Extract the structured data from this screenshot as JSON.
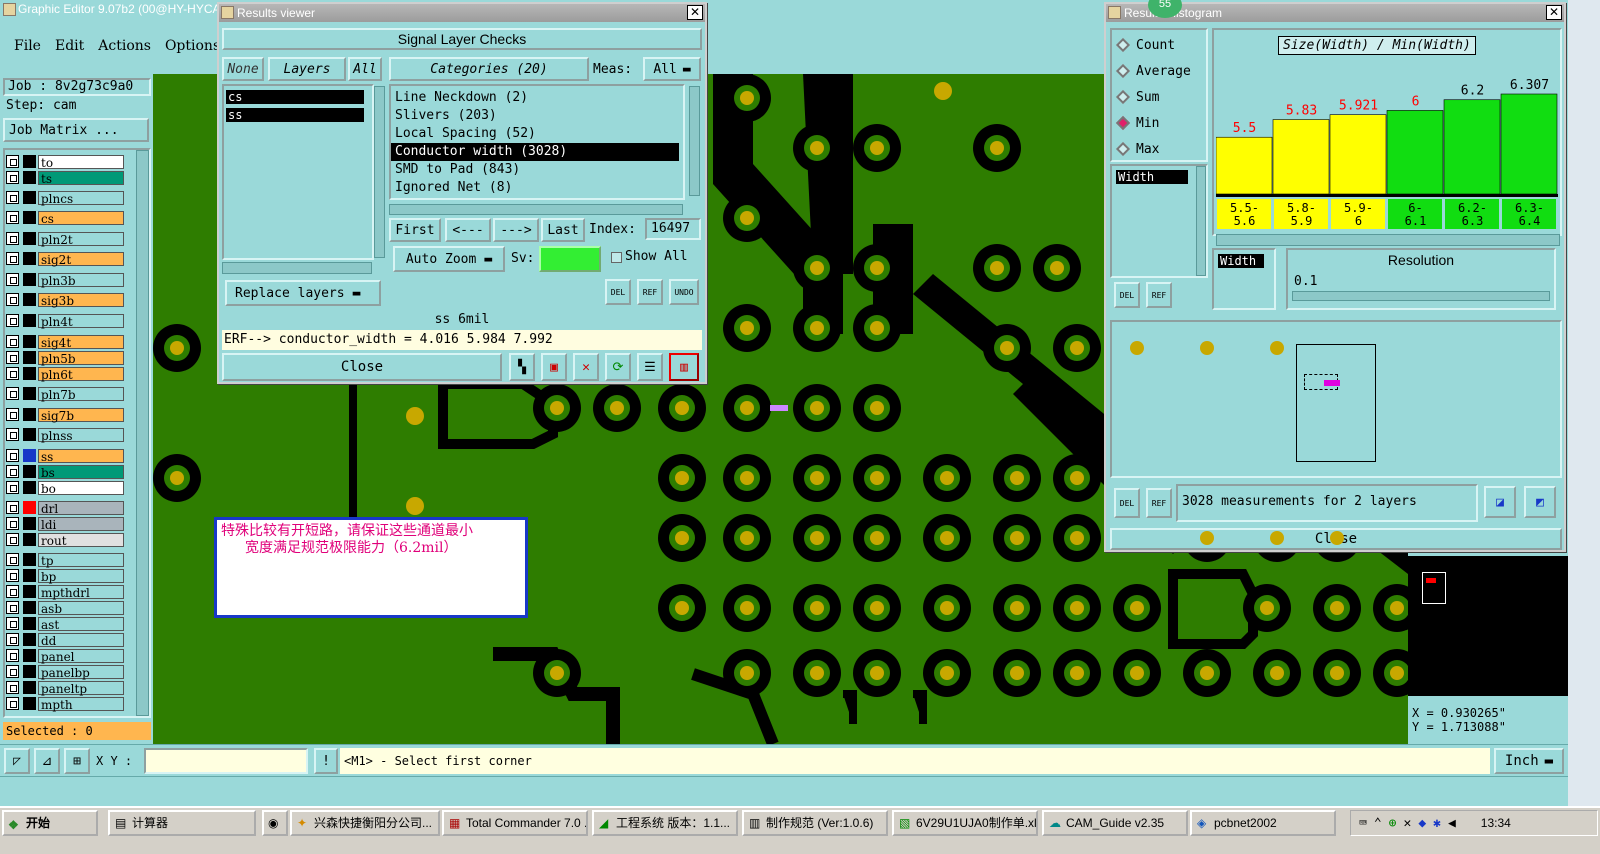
{
  "app": {
    "title": "Graphic Editor 9.07b2 (00@HY-HYCA"
  },
  "menu": [
    "File",
    "Edit",
    "Actions",
    "Options"
  ],
  "job": {
    "job_label": "Job : 8v2g73c9a0",
    "step_label": "Step: cam",
    "matrix_button": "Job Matrix ..."
  },
  "layers": [
    {
      "name": "to",
      "color": "#ffffff"
    },
    {
      "name": "ts",
      "color": "#009977"
    },
    {
      "name": "plncs",
      "color": "#9ad9d9"
    },
    {
      "name": "cs",
      "color": "#ffb64f"
    },
    {
      "name": "pln2t",
      "color": "#9ad9d9"
    },
    {
      "name": "sig2t",
      "color": "#ffb64f"
    },
    {
      "name": "pln3b",
      "color": "#9ad9d9"
    },
    {
      "name": "sig3b",
      "color": "#ffb64f"
    },
    {
      "name": "pln4t",
      "color": "#9ad9d9"
    },
    {
      "name": "sig4t",
      "color": "#ffb64f"
    },
    {
      "name": "pln5b",
      "color": "#ffb64f"
    },
    {
      "name": "pln6t",
      "color": "#ffb64f"
    },
    {
      "name": "pln7b",
      "color": "#9ad9d9"
    },
    {
      "name": "sig7b",
      "color": "#ffb64f"
    },
    {
      "name": "plnss",
      "color": "#9ad9d9"
    },
    {
      "name": "ss",
      "color": "#ffb64f"
    },
    {
      "name": "bs",
      "color": "#009977"
    },
    {
      "name": "bo",
      "color": "#ffffff"
    },
    {
      "name": "drl",
      "color": "#a9b4bb"
    },
    {
      "name": "ldi",
      "color": "#a9b4bb"
    },
    {
      "name": "rout",
      "color": "#e0e0e0"
    },
    {
      "name": "tp",
      "color": "#9ad9d9"
    },
    {
      "name": "bp",
      "color": "#9ad9d9"
    },
    {
      "name": "mpthdrl",
      "color": "#9ad9d9"
    },
    {
      "name": "asb",
      "color": "#9ad9d9"
    },
    {
      "name": "ast",
      "color": "#9ad9d9"
    },
    {
      "name": "dd",
      "color": "#9ad9d9"
    },
    {
      "name": "panel",
      "color": "#9ad9d9"
    },
    {
      "name": "panelbp",
      "color": "#9ad9d9"
    },
    {
      "name": "paneltp",
      "color": "#9ad9d9"
    },
    {
      "name": "mpth",
      "color": "#9ad9d9"
    }
  ],
  "selected": "Selected : 0",
  "results": {
    "title": "Results viewer",
    "header": "Signal Layer Checks",
    "none": "None",
    "layers": "Layers",
    "all": "All",
    "layer_list": [
      "cs",
      "ss"
    ],
    "categories_label": "Categories (20)",
    "meas_label": "Meas:",
    "meas_value": "All",
    "categories": [
      "Line Neckdown (2)",
      "Slivers (203)",
      "Local Spacing (52)",
      "Conductor width (3028)",
      "SMD to Pad (843)",
      "Ignored Net (8)"
    ],
    "first": "First",
    "prev": "<---",
    "next": "--->",
    "last": "Last",
    "index_label": "Index:",
    "index_value": "16497",
    "auto_zoom": "Auto Zoom",
    "sv_label": "Sv:",
    "show_all": "Show All",
    "replace_layers": "Replace layers",
    "status": "ss 6mil",
    "erf": "ERF--> conductor_width = 4.016 5.984 7.992",
    "close": "Close"
  },
  "histogram": {
    "title": "Results Histogram",
    "badge": "55",
    "modes": [
      "Count",
      "Average",
      "Sum",
      "Min",
      "Max"
    ],
    "chart_title": "Size(Width) / Min(Width)",
    "measure_item": "Width",
    "resolution_label": "Resolution",
    "resolution_value": "0.1",
    "summary": "3028 measurements for 2 layers",
    "close": "Close"
  },
  "chart_data": {
    "type": "bar",
    "title": "Size(Width) / Min(Width)",
    "categories": [
      "5.5-5.6",
      "5.8-5.9",
      "5.9-6",
      "6-6.1",
      "6.2-6.3",
      "6.3-6.4"
    ],
    "tick_lines": [
      [
        "5.5-",
        "5.6"
      ],
      [
        "5.8-",
        "5.9"
      ],
      [
        "5.9-",
        "6"
      ],
      [
        "6-",
        "6.1"
      ],
      [
        "6.2-",
        "6.3"
      ],
      [
        "6.3-",
        "6.4"
      ]
    ],
    "values": [
      5.5,
      5.83,
      5.921,
      6,
      6.2,
      6.307
    ],
    "labels": [
      "5.5",
      "5.83",
      "5.921",
      "6",
      "6.2",
      "6.307"
    ],
    "bar_colors": [
      "#ffff00",
      "#ffff00",
      "#ffff00",
      "#11dd11",
      "#11dd11",
      "#11dd11"
    ],
    "label_colors": [
      "#ff0000",
      "#ff0000",
      "#ff0000",
      "#ff0000",
      "#000000",
      "#000000"
    ]
  },
  "coords": {
    "x": "X = 0.930265\"",
    "y": "Y = 1.713088\""
  },
  "note": {
    "line1": "特殊比较有开短路，请保证这些通道最小",
    "line2": "宽度满足规范极限能力（6.2mil）"
  },
  "bottom": {
    "xy_label": "X Y :",
    "prompt": "<M1> - Select first corner",
    "unit": "Inch"
  },
  "taskbar": {
    "start": "开始",
    "buttons": [
      "计算器",
      "兴森快捷衡阳分公司...",
      "Total Commander 7.0 ...",
      "工程系统  版本：1.1...",
      "制作规范 (Ver:1.0.6)",
      "6V29U1UJA0制作单.xl...",
      "CAM_Guide v2.35",
      "pcbnet2002"
    ],
    "clock": "13:34"
  }
}
